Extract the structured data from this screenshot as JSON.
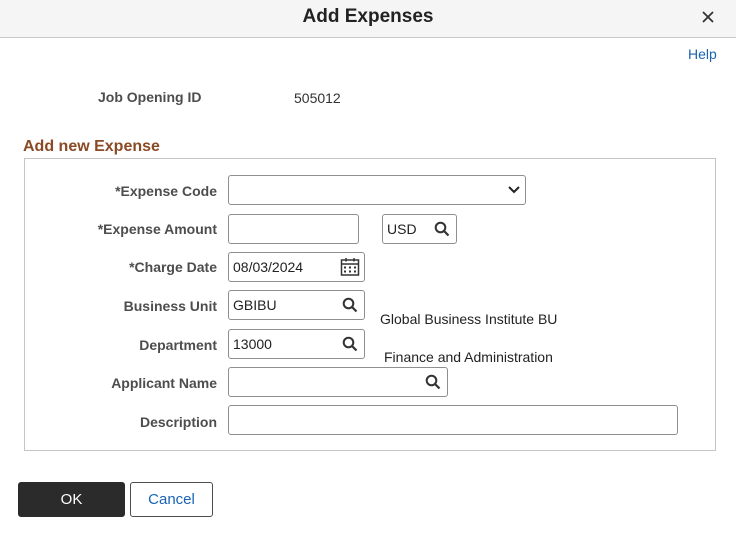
{
  "dialog": {
    "title": "Add Expenses",
    "help": "Help"
  },
  "job_opening": {
    "label": "Job Opening ID",
    "value": "505012"
  },
  "section": {
    "title": "Add new Expense"
  },
  "form": {
    "expense_code": {
      "label": "*Expense Code",
      "value": ""
    },
    "expense_amount": {
      "label": "*Expense Amount",
      "value": "",
      "currency": "USD"
    },
    "charge_date": {
      "label": "*Charge Date",
      "value": "08/03/2024"
    },
    "business_unit": {
      "label": "Business Unit",
      "value": "GBIBU",
      "description": "Global Business Institute BU"
    },
    "department": {
      "label": "Department",
      "value": "13000",
      "description": "Finance and Administration"
    },
    "applicant_name": {
      "label": "Applicant Name",
      "value": ""
    },
    "description": {
      "label": "Description",
      "value": ""
    }
  },
  "buttons": {
    "ok": "OK",
    "cancel": "Cancel"
  },
  "colors": {
    "accent": "#1a63b5",
    "section_title": "#8a4a24",
    "primary_button": "#2b2b2b"
  },
  "icons": [
    "close-icon",
    "search-icon",
    "calendar-icon",
    "chevron-down-icon"
  ]
}
